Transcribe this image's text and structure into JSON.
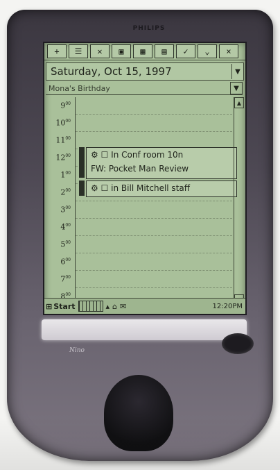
{
  "device": {
    "brand": "PHILIPS",
    "sub_brand": "Nino"
  },
  "toolbar": {
    "buttons": [
      "+",
      "☰",
      "✕",
      "▣",
      "▦",
      "▤",
      "✓",
      "⌄",
      "×"
    ]
  },
  "date_bar": {
    "date": "Saturday, Oct 15, 1997"
  },
  "all_day_event": {
    "text": "Mona's Birthday"
  },
  "hours": [
    "9",
    "10",
    "11",
    "12",
    "1",
    "2",
    "3",
    "4",
    "5",
    "6",
    "7",
    "8"
  ],
  "appointments": [
    {
      "icons": "⚙ ☐",
      "line1": "In Conf room 10n",
      "line2": "FW: Pocket Man Review"
    },
    {
      "icons": "⚙ ☐",
      "line1": "in Bill Mitchell staff"
    }
  ],
  "taskbar": {
    "start_label": "Start",
    "clock": "12:20PM"
  },
  "colors": {
    "lcd": "#a9c09a",
    "device_body": "#4d4853"
  }
}
